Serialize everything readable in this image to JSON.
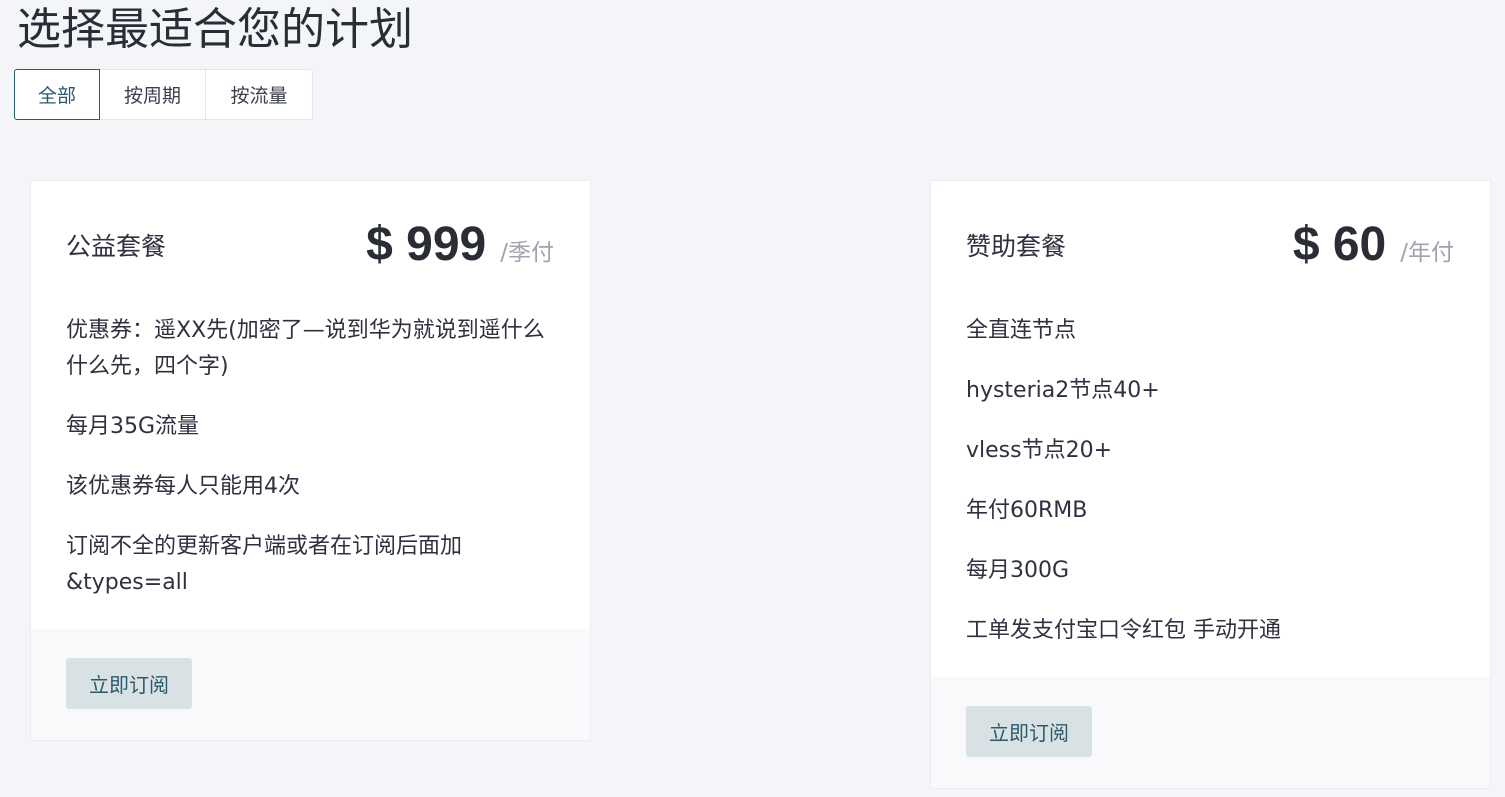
{
  "page": {
    "title": "选择最适合您的计划"
  },
  "filters": {
    "all_label": "全部",
    "by_period_label": "按周期",
    "by_traffic_label": "按流量",
    "active": "全部"
  },
  "plans": [
    {
      "name": "公益套餐",
      "price": "$ 999",
      "period": "/季付",
      "features": [
        "优惠券：遥XX先(加密了—说到华为就说到遥什么什么先，四个字)",
        "每月35G流量",
        "该优惠券每人只能用4次",
        "订阅不全的更新客户端或者在订阅后面加&types=all"
      ],
      "button_label": "立即订阅"
    },
    {
      "name": "赞助套餐",
      "price": "$ 60",
      "period": "/年付",
      "features": [
        "全直连节点",
        "hysteria2节点40+",
        "vless节点20+",
        "年付60RMB",
        "每月300G",
        "工单发支付宝口令红包 手动开通"
      ],
      "button_label": "立即订阅"
    }
  ],
  "colors": {
    "background": "#f4f5f9",
    "accent": "#2d5a6b",
    "button_bg": "#d8e2e5"
  }
}
